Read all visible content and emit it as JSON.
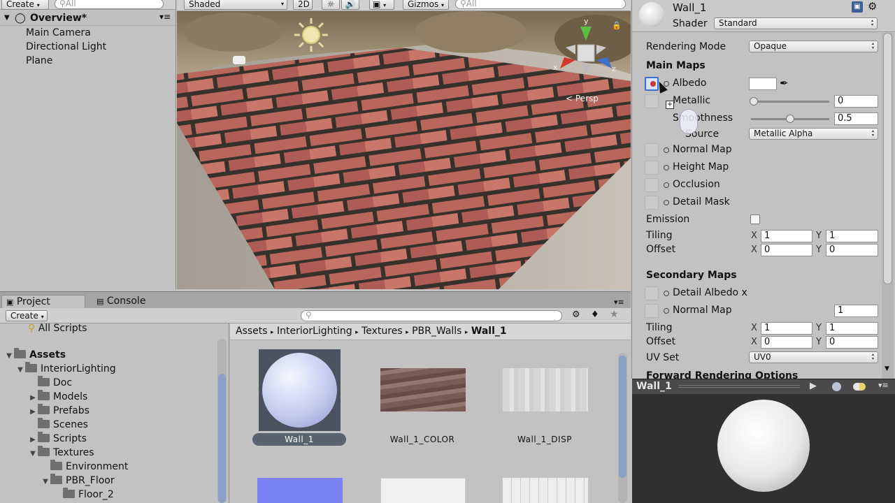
{
  "hierarchy": {
    "create_label": "Create",
    "search_placeholder": "All",
    "scene_name": "Overview*",
    "items": [
      "Main Camera",
      "Directional Light",
      "Plane"
    ]
  },
  "scene": {
    "shading_mode": "Shaded",
    "mode_2d": "2D",
    "gizmos_label": "Gizmos",
    "search_placeholder": "All",
    "persp_label": "Persp",
    "gizmo_axes": {
      "x": "x",
      "y": "y",
      "z": "z"
    }
  },
  "project": {
    "tab_project": "Project",
    "tab_console": "Console",
    "create_label": "Create",
    "all_scripts": "All Scripts",
    "tree": [
      {
        "label": "Assets",
        "depth": 0,
        "expanded": true,
        "bold": true
      },
      {
        "label": "InteriorLighting",
        "depth": 1,
        "expanded": true
      },
      {
        "label": "Doc",
        "depth": 2
      },
      {
        "label": "Models",
        "depth": 2,
        "collapsed": true
      },
      {
        "label": "Prefabs",
        "depth": 2,
        "collapsed": true
      },
      {
        "label": "Scenes",
        "depth": 2
      },
      {
        "label": "Scripts",
        "depth": 2,
        "collapsed": true
      },
      {
        "label": "Textures",
        "depth": 2,
        "expanded": true
      },
      {
        "label": "Environment",
        "depth": 3
      },
      {
        "label": "PBR_Floor",
        "depth": 3,
        "expanded": true
      },
      {
        "label": "Floor_2",
        "depth": 4
      }
    ],
    "breadcrumb": [
      "Assets",
      "InteriorLighting",
      "Textures",
      "PBR_Walls",
      "Wall_1"
    ],
    "assets": [
      "Wall_1",
      "Wall_1_COLOR",
      "Wall_1_DISP"
    ]
  },
  "inspector": {
    "material_name": "Wall_1",
    "shader_label": "Shader",
    "shader_value": "Standard",
    "rendering_mode_label": "Rendering Mode",
    "rendering_mode_value": "Opaque",
    "main_maps_title": "Main Maps",
    "albedo": "Albedo",
    "metallic": "Metallic",
    "metallic_value": "0",
    "smoothness": "Smoothness",
    "smoothness_value": "0.5",
    "source": "Source",
    "source_value": "Metallic Alpha",
    "normal_map": "Normal Map",
    "height_map": "Height Map",
    "occlusion": "Occlusion",
    "detail_mask": "Detail Mask",
    "emission": "Emission",
    "tiling": "Tiling",
    "offset": "Offset",
    "x": "X",
    "y": "Y",
    "main_tiling_x": "1",
    "main_tiling_y": "1",
    "main_offset_x": "0",
    "main_offset_y": "0",
    "secondary_maps_title": "Secondary Maps",
    "detail_albedo": "Detail Albedo x",
    "sec_normal_map": "Normal Map",
    "sec_normal_value": "1",
    "sec_tiling_x": "1",
    "sec_tiling_y": "1",
    "sec_offset_x": "0",
    "sec_offset_y": "0",
    "uv_set_label": "UV Set",
    "uv_set_value": "UV0",
    "forward_options": "Forward Rendering Options",
    "preview_title": "Wall_1",
    "smoothness_level": 0.5,
    "metallic_level": 0
  },
  "colors": {
    "panel": "#c2c2c2",
    "toolbar": "#d6d6d6",
    "accent": "#3d6fd1",
    "preview_bg": "#303030",
    "brick": "#b8594f"
  }
}
